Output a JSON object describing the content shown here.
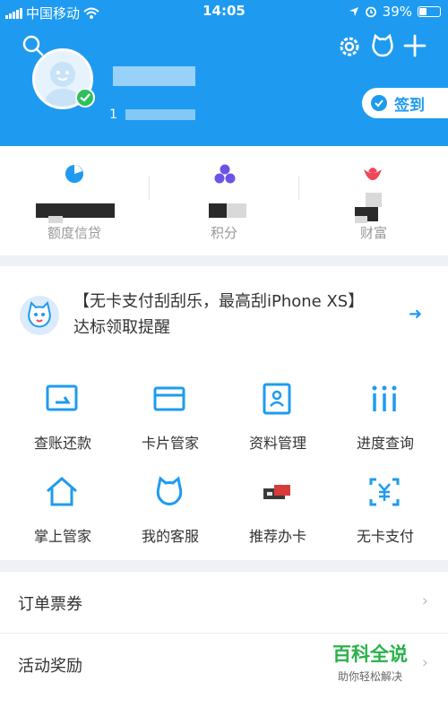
{
  "status_bar": {
    "carrier": "中国移动",
    "time": "14:05",
    "battery": "39%",
    "battery_level": 0.39
  },
  "header": {
    "masked_sub_prefix": "1",
    "checkin_label": "签到"
  },
  "stats": [
    {
      "label": "额度信贷",
      "icon": "credit-pie-icon",
      "color": "#1e9bf0"
    },
    {
      "label": "积分",
      "icon": "points-dots-icon",
      "color": "#6a54e8"
    },
    {
      "label": "财富",
      "icon": "wealth-lotus-icon",
      "color": "#f0465a"
    }
  ],
  "promo": {
    "text": "【无卡支付刮刮乐，最高刮iPhone XS】达标领取提醒"
  },
  "grid": [
    {
      "label": "查账还款",
      "icon": "bill-repay-icon"
    },
    {
      "label": "卡片管家",
      "icon": "card-manager-icon"
    },
    {
      "label": "资料管理",
      "icon": "profile-manage-icon"
    },
    {
      "label": "进度查询",
      "icon": "progress-query-icon"
    },
    {
      "label": "掌上管家",
      "icon": "home-manager-icon"
    },
    {
      "label": "我的客服",
      "icon": "customer-service-icon"
    },
    {
      "label": "推荐办卡",
      "icon": "recommend-card-icon"
    },
    {
      "label": "无卡支付",
      "icon": "cardless-pay-icon"
    }
  ],
  "list": [
    {
      "label": "订单票券"
    },
    {
      "label": "活动奖励"
    }
  ],
  "watermark": {
    "main": "百科全说",
    "sub": "助你轻松解决"
  },
  "colors": {
    "primary": "#1e9bf0",
    "success": "#2fbf5f"
  }
}
